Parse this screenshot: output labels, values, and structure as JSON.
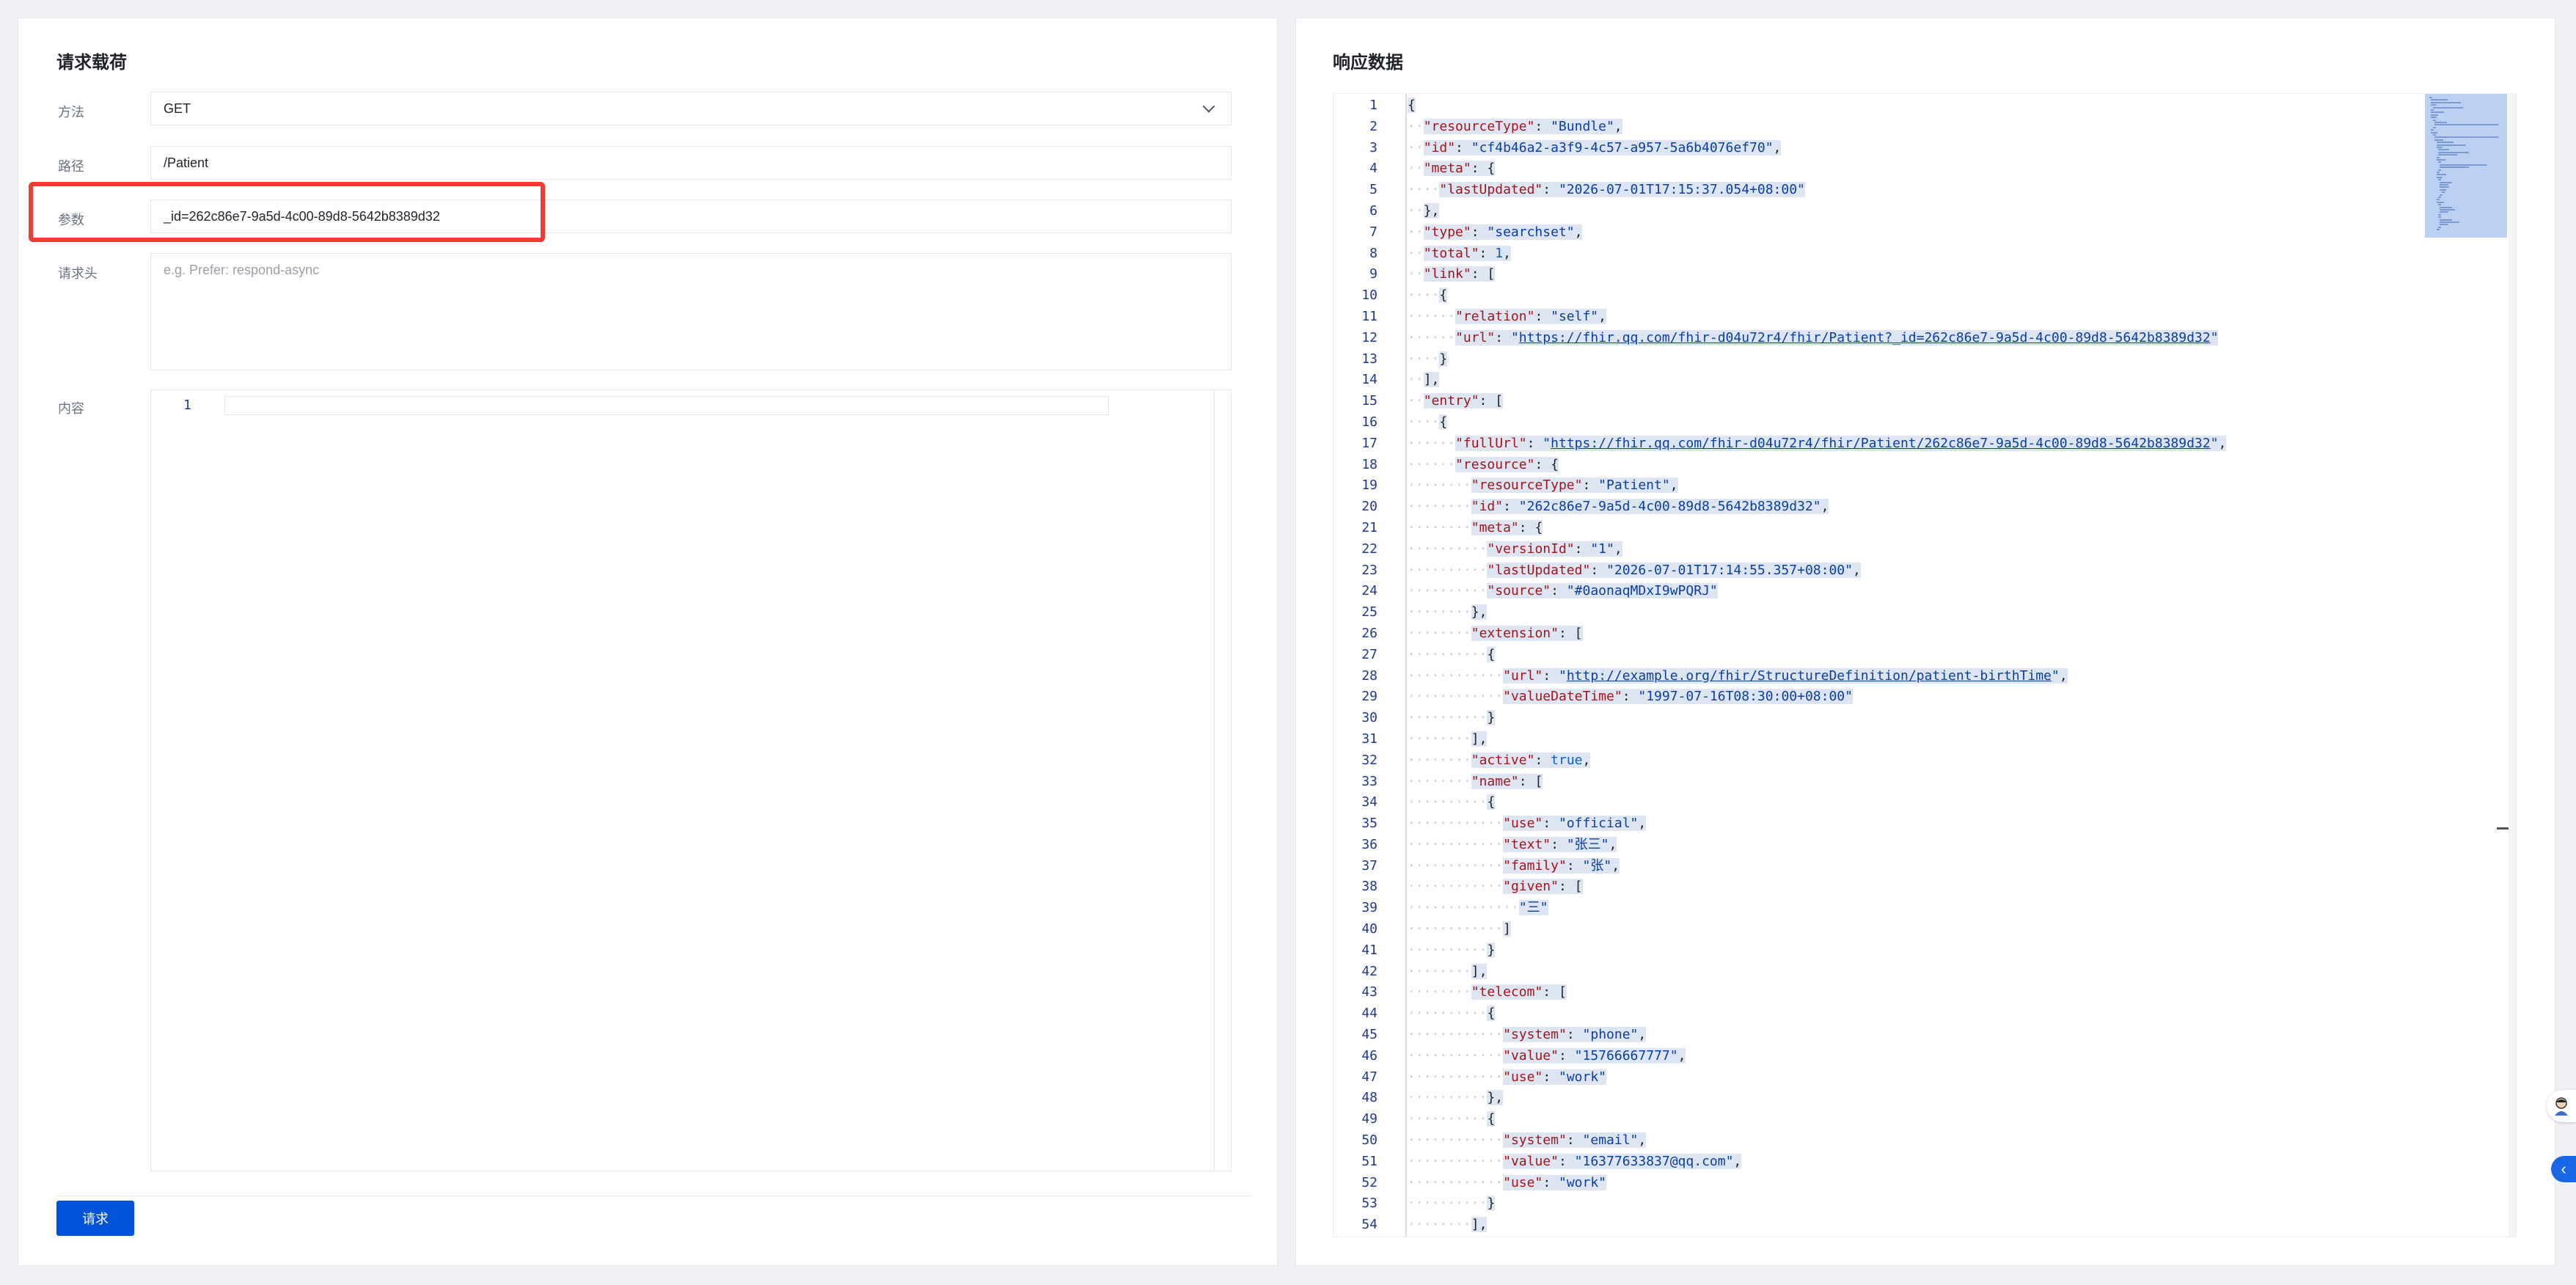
{
  "request_panel": {
    "title": "请求载荷",
    "method_label": "方法",
    "method_value": "GET",
    "path_label": "路径",
    "path_value": "/Patient",
    "params_label": "参数",
    "params_value": "_id=262c86e7-9a5d-4c00-89d8-5642b8389d32",
    "headers_label": "请求头",
    "headers_placeholder": "e.g. Prefer: respond-async",
    "body_label": "内容",
    "body_line_number": "1",
    "submit_label": "请求"
  },
  "response_panel": {
    "title": "响应数据",
    "lines": [
      "{",
      "  \"resourceType\": \"Bundle\",",
      "  \"id\": \"cf4b46a2-a3f9-4c57-a957-5a6b4076ef70\",",
      "  \"meta\": {",
      "    \"lastUpdated\": \"2026-07-01T17:15:37.054+08:00\"",
      "  },",
      "  \"type\": \"searchset\",",
      "  \"total\": 1,",
      "  \"link\": [",
      "    {",
      "      \"relation\": \"self\",",
      "      \"url\": \"https://fhir.qq.com/fhir-d04u72r4/fhir/Patient?_id=262c86e7-9a5d-4c00-89d8-5642b8389d32\"",
      "    }",
      "  ],",
      "  \"entry\": [",
      "    {",
      "      \"fullUrl\": \"https://fhir.qq.com/fhir-d04u72r4/fhir/Patient/262c86e7-9a5d-4c00-89d8-5642b8389d32\",",
      "      \"resource\": {",
      "        \"resourceType\": \"Patient\",",
      "        \"id\": \"262c86e7-9a5d-4c00-89d8-5642b8389d32\",",
      "        \"meta\": {",
      "          \"versionId\": \"1\",",
      "          \"lastUpdated\": \"2026-07-01T17:14:55.357+08:00\",",
      "          \"source\": \"#0aonaqMDxI9wPQRJ\"",
      "        },",
      "        \"extension\": [",
      "          {",
      "            \"url\": \"http://example.org/fhir/StructureDefinition/patient-birthTime\",",
      "            \"valueDateTime\": \"1997-07-16T08:30:00+08:00\"",
      "          }",
      "        ],",
      "        \"active\": true,",
      "        \"name\": [",
      "          {",
      "            \"use\": \"official\",",
      "            \"text\": \"张三\",",
      "            \"family\": \"张\",",
      "            \"given\": [",
      "              \"三\"",
      "            ]",
      "          }",
      "        ],",
      "        \"telecom\": [",
      "          {",
      "            \"system\": \"phone\",",
      "            \"value\": \"15766667777\",",
      "            \"use\": \"work\"",
      "          },",
      "          {",
      "            \"system\": \"email\",",
      "            \"value\": \"16377633837@qq.com\",",
      "            \"use\": \"work\"",
      "          }",
      "        ],"
    ]
  },
  "colors": {
    "accent": "#0052d9",
    "highlight_border": "#ef3b34",
    "json_key": "#a3151c",
    "json_string": "#0b3f9c",
    "selection": "#dde5f3"
  },
  "icons": {
    "method_select": "chevron-down-icon",
    "floating_avatar": "avatar-icon",
    "collapse": "chevron-left-icon"
  }
}
